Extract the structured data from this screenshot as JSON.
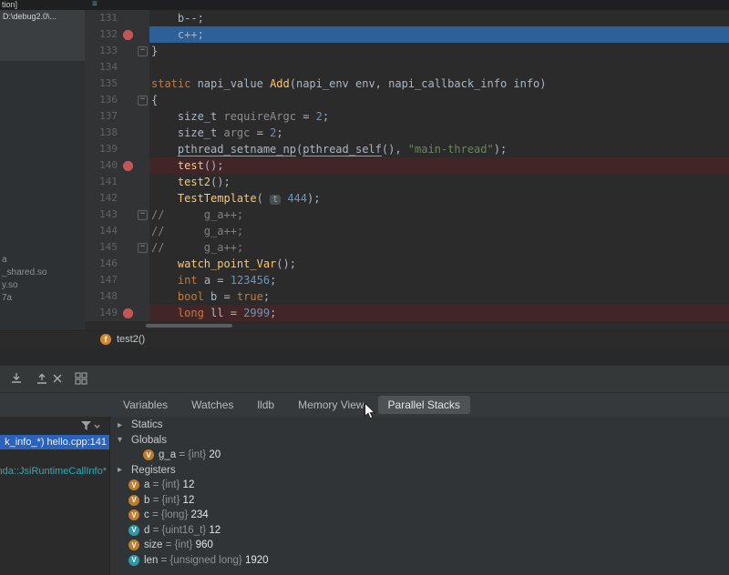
{
  "palette": {
    "exec_line_bg": "#2d6099",
    "breakpoint_line_bg": "#412527",
    "breakpoint_icon_color": "#c75450",
    "keyword_color": "#cc7832",
    "number_color": "#6897bb",
    "string_color": "#6a8759",
    "comment_color": "#808080",
    "function_color": "#ffc66b",
    "selection_blue": "#2a63bd",
    "teal_text": "#2aacb8",
    "variable_icon_orange": "#c07c28",
    "variable_icon_teal": "#2d98a8"
  },
  "top": {
    "window_title_fragment": "tion]",
    "path_fragment": "D:\\debug2.0\\...",
    "list_icon": "list-icon"
  },
  "left_panel": {
    "items": [
      "a",
      "_shared.so",
      "y.so",
      "7a"
    ]
  },
  "editor": {
    "lines": [
      {
        "num": "131",
        "bg": "",
        "bp": false,
        "fold": "",
        "segs": [
          {
            "t": "    b--;",
            "c": "plain"
          }
        ]
      },
      {
        "num": "132",
        "bg": "exec",
        "bp": true,
        "fold": "",
        "segs": [
          {
            "t": "    c++;",
            "c": "plain"
          }
        ]
      },
      {
        "num": "133",
        "bg": "",
        "bp": false,
        "fold": "minus",
        "segs": [
          {
            "t": "}",
            "c": "plain"
          }
        ]
      },
      {
        "num": "134",
        "bg": "",
        "bp": false,
        "fold": "",
        "segs": []
      },
      {
        "num": "135",
        "bg": "",
        "bp": false,
        "fold": "",
        "segs": [
          {
            "t": "static",
            "c": "kw"
          },
          {
            "t": " napi_value ",
            "c": "plain"
          },
          {
            "t": "Add",
            "c": "fn"
          },
          {
            "t": "(napi_env env, napi_callback_info info)",
            "c": "plain"
          }
        ]
      },
      {
        "num": "136",
        "bg": "",
        "bp": false,
        "fold": "minus",
        "segs": [
          {
            "t": "{",
            "c": "plain"
          }
        ]
      },
      {
        "num": "137",
        "bg": "",
        "bp": false,
        "fold": "",
        "segs": [
          {
            "t": "    size_t ",
            "c": "plain"
          },
          {
            "t": "requireArgc",
            "c": "muted"
          },
          {
            "t": " = ",
            "c": "plain"
          },
          {
            "t": "2",
            "c": "num"
          },
          {
            "t": ";",
            "c": "plain"
          }
        ]
      },
      {
        "num": "138",
        "bg": "",
        "bp": false,
        "fold": "",
        "segs": [
          {
            "t": "    size_t ",
            "c": "plain"
          },
          {
            "t": "argc",
            "c": "muted"
          },
          {
            "t": " = ",
            "c": "plain"
          },
          {
            "t": "2",
            "c": "num"
          },
          {
            "t": ";",
            "c": "plain"
          }
        ]
      },
      {
        "num": "139",
        "bg": "",
        "bp": false,
        "fold": "",
        "segs": [
          {
            "t": "    ",
            "c": "plain"
          },
          {
            "t": "pthread_setname_np",
            "c": "plain underline"
          },
          {
            "t": "(",
            "c": "plain"
          },
          {
            "t": "pthread_self",
            "c": "plain underline"
          },
          {
            "t": "(), ",
            "c": "plain"
          },
          {
            "t": "\"main-thread\"",
            "c": "str"
          },
          {
            "t": ");",
            "c": "plain"
          }
        ]
      },
      {
        "num": "140",
        "bg": "bp",
        "bp": true,
        "fold": "",
        "segs": [
          {
            "t": "    ",
            "c": "plain"
          },
          {
            "t": "test",
            "c": "fn"
          },
          {
            "t": "();",
            "c": "plain"
          }
        ]
      },
      {
        "num": "141",
        "bg": "",
        "bp": false,
        "fold": "",
        "segs": [
          {
            "t": "    ",
            "c": "plain"
          },
          {
            "t": "test2",
            "c": "fn"
          },
          {
            "t": "();",
            "c": "plain"
          }
        ]
      },
      {
        "num": "142",
        "bg": "",
        "bp": false,
        "fold": "",
        "segs": [
          {
            "t": "    ",
            "c": "plain"
          },
          {
            "t": "TestTemplate",
            "c": "fn"
          },
          {
            "t": "( ",
            "c": "plain"
          },
          {
            "t": "t",
            "c": "hint"
          },
          {
            "t": " ",
            "c": "plain"
          },
          {
            "t": "444",
            "c": "num"
          },
          {
            "t": ");",
            "c": "plain"
          }
        ]
      },
      {
        "num": "143",
        "bg": "",
        "bp": false,
        "fold": "minus",
        "segs": [
          {
            "t": "//      g_a++;",
            "c": "comment"
          }
        ]
      },
      {
        "num": "144",
        "bg": "",
        "bp": false,
        "fold": "",
        "segs": [
          {
            "t": "//      g_a++;",
            "c": "comment"
          }
        ]
      },
      {
        "num": "145",
        "bg": "",
        "bp": false,
        "fold": "minus",
        "segs": [
          {
            "t": "//      g_a++;",
            "c": "comment"
          }
        ]
      },
      {
        "num": "146",
        "bg": "",
        "bp": false,
        "fold": "",
        "segs": [
          {
            "t": "    ",
            "c": "plain"
          },
          {
            "t": "watch_point_Var",
            "c": "fn"
          },
          {
            "t": "();",
            "c": "plain"
          }
        ]
      },
      {
        "num": "147",
        "bg": "",
        "bp": false,
        "fold": "",
        "segs": [
          {
            "t": "    ",
            "c": "plain"
          },
          {
            "t": "int",
            "c": "kw"
          },
          {
            "t": " a = ",
            "c": "plain"
          },
          {
            "t": "123456",
            "c": "num"
          },
          {
            "t": ";",
            "c": "plain"
          }
        ]
      },
      {
        "num": "148",
        "bg": "",
        "bp": false,
        "fold": "",
        "segs": [
          {
            "t": "    ",
            "c": "plain"
          },
          {
            "t": "bool",
            "c": "kw"
          },
          {
            "t": " b = ",
            "c": "plain"
          },
          {
            "t": "true",
            "c": "kw"
          },
          {
            "t": ";",
            "c": "plain"
          }
        ]
      },
      {
        "num": "149",
        "bg": "bp",
        "bp": true,
        "fold": "",
        "segs": [
          {
            "t": "    ",
            "c": "plain"
          },
          {
            "t": "long",
            "c": "kw"
          },
          {
            "t": " ll = ",
            "c": "plain"
          },
          {
            "t": "2999",
            "c": "num"
          },
          {
            "t": ";",
            "c": "plain"
          }
        ]
      }
    ]
  },
  "breadcrumb": {
    "icon_letter": "f",
    "label": "test2()"
  },
  "debug_panel": {
    "toolbar_icons": [
      "step-into-icon",
      "step-out-icon",
      "remove-watch-icon",
      "layout-grid-icon"
    ],
    "filter_icon": "funnel-icon",
    "tabs": [
      {
        "label": "Variables",
        "active": false
      },
      {
        "label": "Watches",
        "active": false
      },
      {
        "label": "lldb",
        "active": false
      },
      {
        "label": "Memory View",
        "active": false
      },
      {
        "label": "Parallel Stacks",
        "active": true
      }
    ]
  },
  "frames": {
    "rows": [
      {
        "text": "k_info_*) hello.cpp:141",
        "selected": true,
        "color": ""
      },
      {
        "text": "nda::JsiRuntimeCallInfo*",
        "selected": false,
        "color": "teal"
      }
    ]
  },
  "variables": {
    "rows": [
      {
        "kind": "group",
        "label": "Statics",
        "expanded": false,
        "indent": 0
      },
      {
        "kind": "group",
        "label": "Globals",
        "expanded": true,
        "indent": 0
      },
      {
        "kind": "var",
        "name": "g_a",
        "type": "{int}",
        "value": "20",
        "icon": "orange",
        "indent": 1
      },
      {
        "kind": "group",
        "label": "Registers",
        "expanded": false,
        "indent": 0
      },
      {
        "kind": "var",
        "name": "a",
        "type": "{int}",
        "value": "12",
        "icon": "orange",
        "indent": 0
      },
      {
        "kind": "var",
        "name": "b",
        "type": "{int}",
        "value": "12",
        "icon": "orange",
        "indent": 0
      },
      {
        "kind": "var",
        "name": "c",
        "type": "{long}",
        "value": "234",
        "icon": "orange",
        "indent": 0
      },
      {
        "kind": "var",
        "name": "d",
        "type": "{uint16_t}",
        "value": "12",
        "icon": "teal",
        "indent": 0
      },
      {
        "kind": "var",
        "name": "size",
        "type": "{int}",
        "value": "960",
        "icon": "orange",
        "indent": 0
      },
      {
        "kind": "var",
        "name": "len",
        "type": "{unsigned long}",
        "value": "1920",
        "icon": "teal",
        "indent": 0
      }
    ]
  }
}
